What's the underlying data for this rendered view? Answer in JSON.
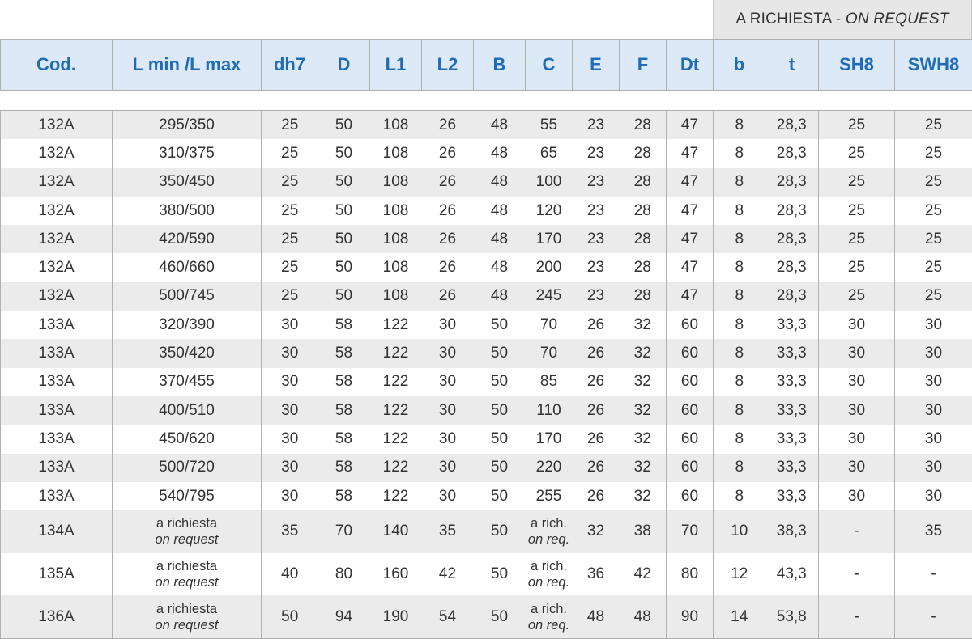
{
  "banner": {
    "it": "A RICHIESTA - ",
    "en": "ON REQUEST"
  },
  "headers": [
    "Cod.",
    "L min /L max",
    "dh7",
    "D",
    "L1",
    "L2",
    "B",
    "C",
    "E",
    "F",
    "Dt",
    "b",
    "t",
    "SH8",
    "SWH8"
  ],
  "rows": [
    [
      "132A",
      "295/350",
      "25",
      "50",
      "108",
      "26",
      "48",
      "55",
      "23",
      "28",
      "47",
      "8",
      "28,3",
      "25",
      "25"
    ],
    [
      "132A",
      "310/375",
      "25",
      "50",
      "108",
      "26",
      "48",
      "65",
      "23",
      "28",
      "47",
      "8",
      "28,3",
      "25",
      "25"
    ],
    [
      "132A",
      "350/450",
      "25",
      "50",
      "108",
      "26",
      "48",
      "100",
      "23",
      "28",
      "47",
      "8",
      "28,3",
      "25",
      "25"
    ],
    [
      "132A",
      "380/500",
      "25",
      "50",
      "108",
      "26",
      "48",
      "120",
      "23",
      "28",
      "47",
      "8",
      "28,3",
      "25",
      "25"
    ],
    [
      "132A",
      "420/590",
      "25",
      "50",
      "108",
      "26",
      "48",
      "170",
      "23",
      "28",
      "47",
      "8",
      "28,3",
      "25",
      "25"
    ],
    [
      "132A",
      "460/660",
      "25",
      "50",
      "108",
      "26",
      "48",
      "200",
      "23",
      "28",
      "47",
      "8",
      "28,3",
      "25",
      "25"
    ],
    [
      "132A",
      "500/745",
      "25",
      "50",
      "108",
      "26",
      "48",
      "245",
      "23",
      "28",
      "47",
      "8",
      "28,3",
      "25",
      "25"
    ],
    [
      "133A",
      "320/390",
      "30",
      "58",
      "122",
      "30",
      "50",
      "70",
      "26",
      "32",
      "60",
      "8",
      "33,3",
      "30",
      "30"
    ],
    [
      "133A",
      "350/420",
      "30",
      "58",
      "122",
      "30",
      "50",
      "70",
      "26",
      "32",
      "60",
      "8",
      "33,3",
      "30",
      "30"
    ],
    [
      "133A",
      "370/455",
      "30",
      "58",
      "122",
      "30",
      "50",
      "85",
      "26",
      "32",
      "60",
      "8",
      "33,3",
      "30",
      "30"
    ],
    [
      "133A",
      "400/510",
      "30",
      "58",
      "122",
      "30",
      "50",
      "110",
      "26",
      "32",
      "60",
      "8",
      "33,3",
      "30",
      "30"
    ],
    [
      "133A",
      "450/620",
      "30",
      "58",
      "122",
      "30",
      "50",
      "170",
      "26",
      "32",
      "60",
      "8",
      "33,3",
      "30",
      "30"
    ],
    [
      "133A",
      "500/720",
      "30",
      "58",
      "122",
      "30",
      "50",
      "220",
      "26",
      "32",
      "60",
      "8",
      "33,3",
      "30",
      "30"
    ],
    [
      "133A",
      "540/795",
      "30",
      "58",
      "122",
      "30",
      "50",
      "255",
      "26",
      "32",
      "60",
      "8",
      "33,3",
      "30",
      "30"
    ],
    [
      "134A",
      [
        "a richiesta",
        "on request"
      ],
      "35",
      "70",
      "140",
      "35",
      "50",
      [
        "a rich.",
        "on req."
      ],
      "32",
      "38",
      "70",
      "10",
      "38,3",
      "-",
      "35"
    ],
    [
      "135A",
      [
        "a richiesta",
        "on request"
      ],
      "40",
      "80",
      "160",
      "42",
      "50",
      [
        "a rich.",
        "on req."
      ],
      "36",
      "42",
      "80",
      "12",
      "43,3",
      "-",
      "-"
    ],
    [
      "136A",
      [
        "a richiesta",
        "on request"
      ],
      "50",
      "94",
      "190",
      "54",
      "50",
      [
        "a rich.",
        "on req."
      ],
      "48",
      "48",
      "90",
      "14",
      "53,8",
      "-",
      "-"
    ]
  ]
}
